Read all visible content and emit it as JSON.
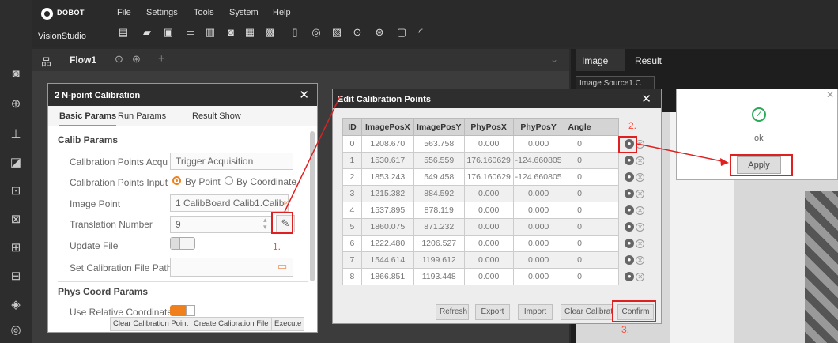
{
  "app": {
    "brand": "DOBOT",
    "name": "VisionStudio"
  },
  "menu": [
    "File",
    "Settings",
    "Tools",
    "System",
    "Help"
  ],
  "flow": {
    "title": "Flow1"
  },
  "right_tabs": {
    "image": "Image",
    "result": "Result"
  },
  "image_source_label": "Image Source1.C",
  "dialog_calib": {
    "title": "2 N-point Calibration",
    "tabs": [
      "Basic Params",
      "Run Params",
      "Result Show"
    ],
    "section_calib": "Calib Params",
    "acq_label": "Calibration Points Acquisi",
    "acq_value": "Trigger Acquisition",
    "input_label": "Calibration Points Input",
    "input_opt1": "By Point",
    "input_opt2": "By Coordinate",
    "image_point_label": "Image Point",
    "image_point_value": "1 CalibBoard Calib1.Calib",
    "translation_label": "Translation Number",
    "translation_value": "9",
    "update_file_label": "Update File",
    "set_path_label": "Set Calibration File Path",
    "section_phys": "Phys Coord Params",
    "relative_label": "Use Relative Coordinates",
    "buttons": [
      "Clear Calibration Point",
      "Create Calibration File",
      "Execute"
    ]
  },
  "dialog_edit": {
    "title": "Edit Calibration Points",
    "columns": [
      "ID",
      "ImagePosX",
      "ImagePosY",
      "PhyPosX",
      "PhyPosY",
      "Angle"
    ],
    "rows": [
      [
        "0",
        "1208.670",
        "563.758",
        "0.000",
        "0.000",
        "0"
      ],
      [
        "1",
        "1530.617",
        "556.559",
        "176.160629",
        "-124.660805",
        "0"
      ],
      [
        "2",
        "1853.243",
        "549.458",
        "176.160629",
        "-124.660805",
        "0"
      ],
      [
        "3",
        "1215.382",
        "884.592",
        "0.000",
        "0.000",
        "0"
      ],
      [
        "4",
        "1537.895",
        "878.119",
        "0.000",
        "0.000",
        "0"
      ],
      [
        "5",
        "1860.075",
        "871.232",
        "0.000",
        "0.000",
        "0"
      ],
      [
        "6",
        "1222.480",
        "1206.527",
        "0.000",
        "0.000",
        "0"
      ],
      [
        "7",
        "1544.614",
        "1199.612",
        "0.000",
        "0.000",
        "0"
      ],
      [
        "8",
        "1866.851",
        "1193.448",
        "0.000",
        "0.000",
        "0"
      ]
    ],
    "buttons": [
      "Refresh",
      "Export",
      "Import",
      "Clear Calibrat",
      "Confirm"
    ]
  },
  "dialog_ok": {
    "message": "ok",
    "button": "Apply"
  },
  "annotations": {
    "step1": "1.",
    "step2": "2.",
    "step3": "3."
  },
  "colors": {
    "highlight": "#e02020",
    "toggle": "#f0801c",
    "radio": "#f0801c"
  }
}
